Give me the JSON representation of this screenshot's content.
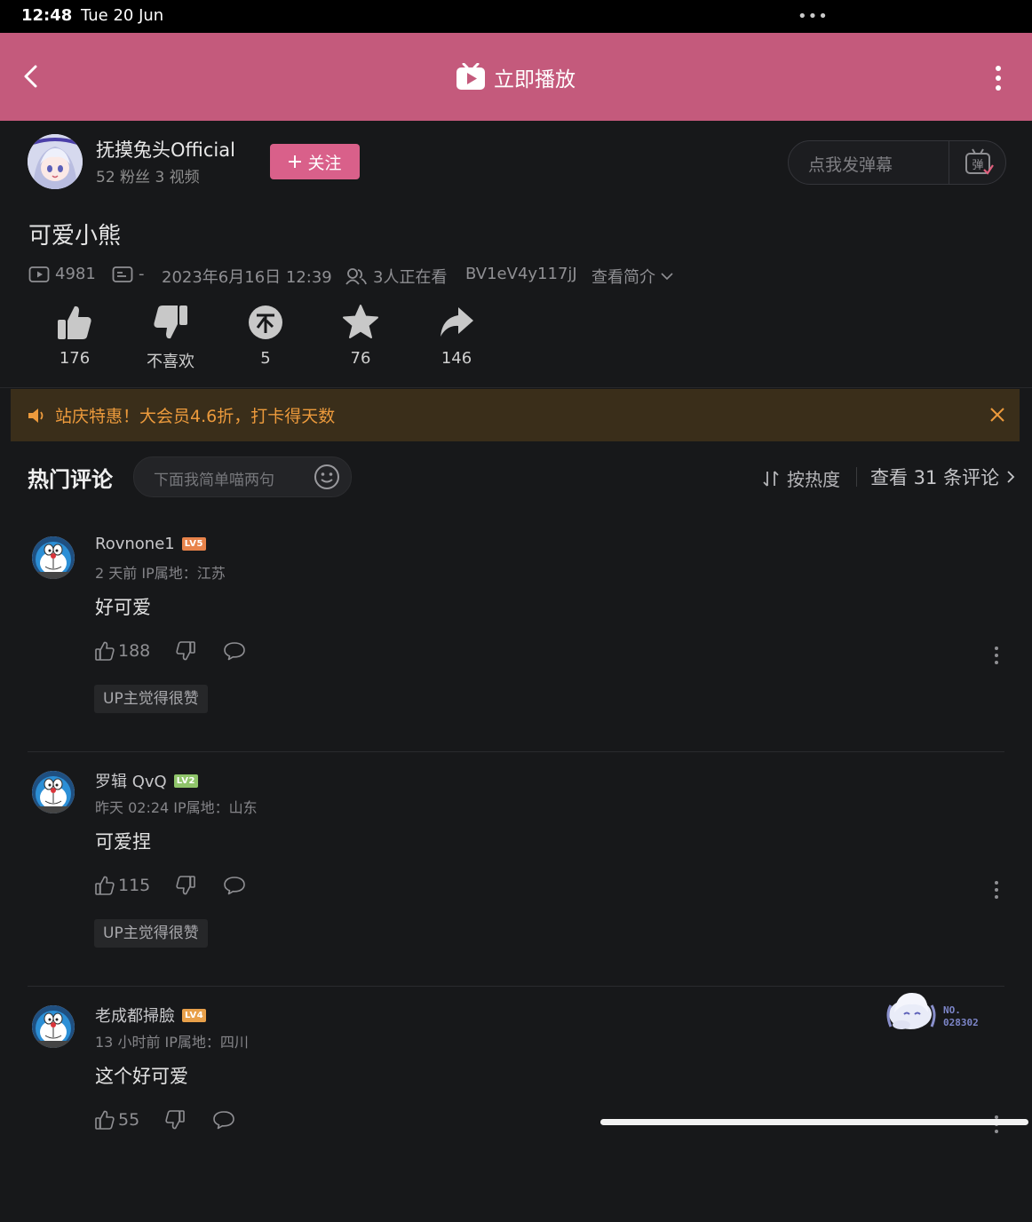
{
  "status_bar": {
    "time": "12:48",
    "date": "Tue 20 Jun",
    "dots": "•••"
  },
  "header": {
    "play_label": "立即播放"
  },
  "author": {
    "name": "抚摸兔头Official",
    "stats": "52 粉丝  3 视频",
    "follow_label": "关注"
  },
  "danmaku": {
    "placeholder": "点我发弹幕",
    "icon_label": "弹"
  },
  "video": {
    "title": "可爱小熊",
    "views": "4981",
    "danmaku_count": "-",
    "publish_time": "2023年6月16日  12:39",
    "watching": "3人正在看",
    "bvid": "BV1eV4y117jJ",
    "intro_label": "查看简介"
  },
  "actions": {
    "like": "176",
    "dislike": "不喜欢",
    "coin": "5",
    "favorite": "76",
    "share": "146"
  },
  "promo": {
    "text": "站庆特惠！大会员4.6折，打卡得天数"
  },
  "comments_header": {
    "title": "热门评论",
    "input_placeholder": "下面我简单喵两句",
    "sort_label": "按热度",
    "view_all": "查看 31 条评论"
  },
  "comments": [
    {
      "user": "Rovnone1",
      "level": "LV5",
      "level_color": "#e8834a",
      "meta": "2 天前   IP属地：江苏",
      "text": "好可爱",
      "likes": "188",
      "badge": "UP主觉得很赞"
    },
    {
      "user": "罗辑 QvQ",
      "level": "LV2",
      "level_color": "#8fc46a",
      "meta": "昨天 02:24   IP属地：山东",
      "text": "可爱捏",
      "likes": "115",
      "badge": "UP主觉得很赞"
    },
    {
      "user": "老成都掃臉",
      "level": "LV4",
      "level_color": "#e8a04a",
      "meta": "13 小时前   IP属地：四川",
      "text": "这个好可爱",
      "likes": "55",
      "badge": ""
    }
  ],
  "sticker": {
    "line1": "NO.",
    "line2": "028302"
  }
}
